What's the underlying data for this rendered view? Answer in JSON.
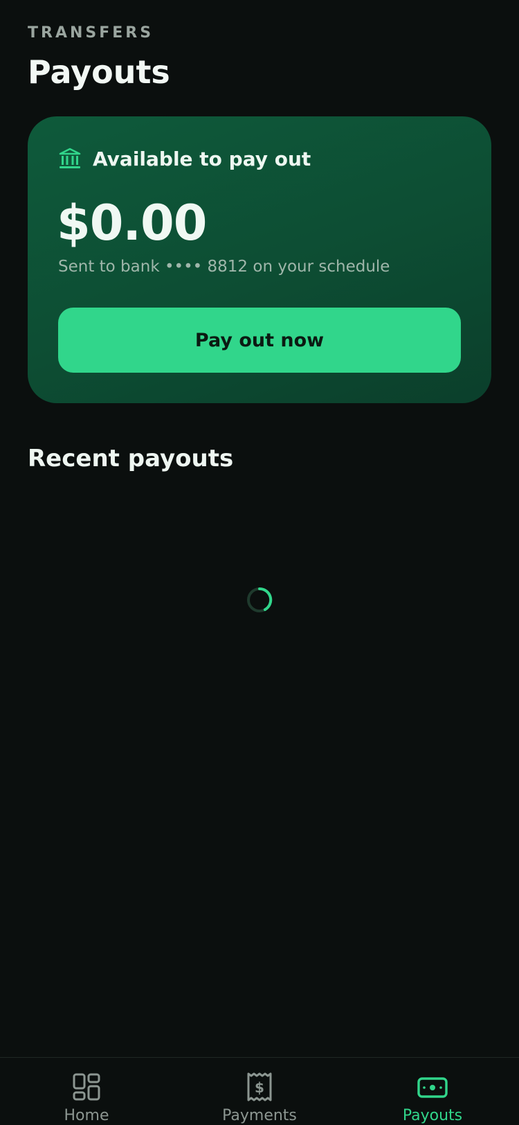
{
  "header": {
    "eyebrow": "TRANSFERS",
    "title": "Payouts"
  },
  "balance_card": {
    "label": "Available to pay out",
    "icon": "bank-icon",
    "amount": "$0.00",
    "subtitle": "Sent to bank •••• 8812 on your schedule",
    "button_label": "Pay out now"
  },
  "recent": {
    "title": "Recent payouts",
    "loading": true
  },
  "tabbar": {
    "active": "payouts",
    "items": [
      {
        "label": "Home",
        "icon": "grid-icon"
      },
      {
        "label": "Payments",
        "icon": "receipt-dollar-icon"
      },
      {
        "label": "Payouts",
        "icon": "banknote-icon"
      }
    ]
  },
  "colors": {
    "background": "#0b0f0e",
    "accent": "#31d68b",
    "card": "#0e5a3b",
    "muted": "#8c9691"
  }
}
